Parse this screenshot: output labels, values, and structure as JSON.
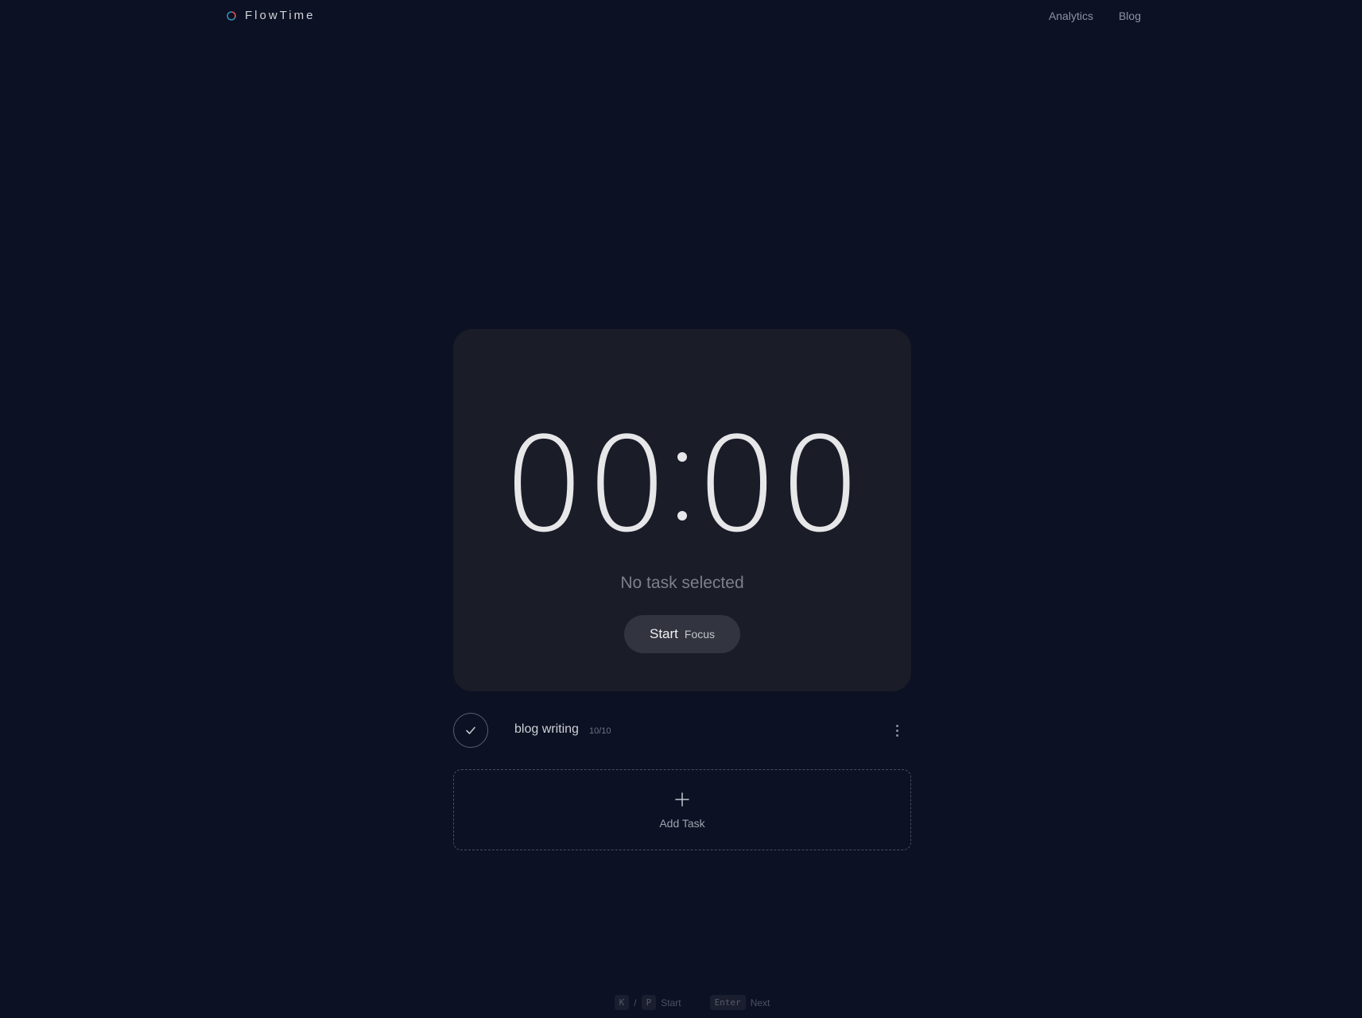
{
  "header": {
    "brand_name": "FlowTime",
    "nav": [
      {
        "label": "Analytics"
      },
      {
        "label": "Blog"
      }
    ]
  },
  "timer": {
    "minutes_d1": "0",
    "minutes_d2": "0",
    "seconds_d1": "0",
    "seconds_d2": "0",
    "status": "No task selected",
    "start_label": "Start",
    "start_sub": "Focus"
  },
  "tasks": [
    {
      "name": "blog writing",
      "count": "10/10"
    }
  ],
  "add_task": {
    "label": "Add Task"
  },
  "shortcuts": {
    "start_key_1": "K",
    "separator": "/",
    "start_key_2": "P",
    "start_label": "Start",
    "next_key": "Enter",
    "next_label": "Next"
  },
  "colors": {
    "background": "#0c1123",
    "card": "#1a1c28",
    "logo_red": "#e5484d",
    "logo_teal": "#3aa0b8"
  }
}
